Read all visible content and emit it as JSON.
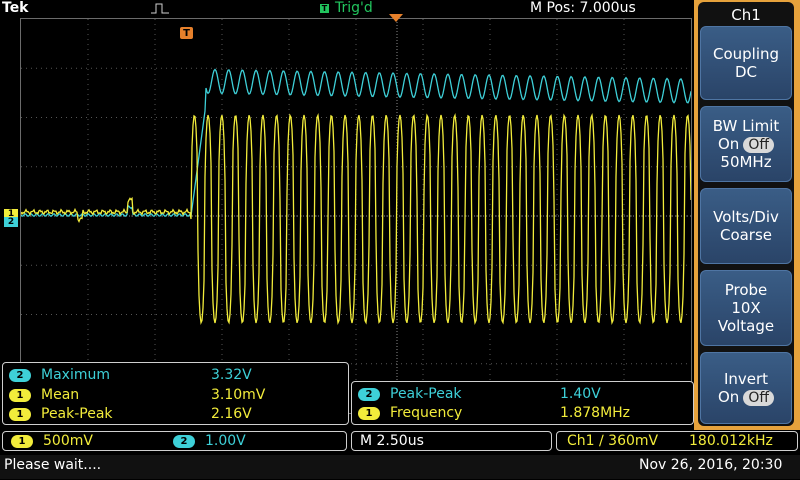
{
  "header": {
    "brand": "Tek",
    "trigger_status": "Trig'd",
    "m_pos": "M Pos: 7.000us"
  },
  "channels": {
    "ch1": {
      "label": "1",
      "color": "#f2ec3b"
    },
    "ch2": {
      "label": "2",
      "color": "#3ed0d8"
    }
  },
  "trigger_marker": {
    "label": "T"
  },
  "measurements_left": [
    {
      "channel": "2",
      "name": "Maximum",
      "value": "3.32V"
    },
    {
      "channel": "1",
      "name": "Mean",
      "value": "3.10mV"
    },
    {
      "channel": "1",
      "name": "Peak-Peak",
      "value": "2.16V"
    }
  ],
  "measurements_right": [
    {
      "channel": "2",
      "name": "Peak-Peak",
      "value": "1.40V"
    },
    {
      "channel": "1",
      "name": "Frequency",
      "value": "1.878MHz"
    }
  ],
  "status_bar": {
    "ch1_scale": "500mV",
    "ch2_scale": "1.00V",
    "timebase": "M 2.50us",
    "trigger_info": "Ch1 ∕ 360mV",
    "trigger_freq": "180.012kHz"
  },
  "bottom": {
    "message": "Please wait....",
    "datetime": "Nov 26, 2016, 20:30"
  },
  "side_menu": {
    "title": "Ch1",
    "coupling_label": "Coupling",
    "coupling_value": "DC",
    "bw_label": "BW Limit",
    "bw_on": "On",
    "bw_off": "Off",
    "bw_value": "50MHz",
    "volts_label": "Volts/Div",
    "volts_value": "Coarse",
    "probe_label": "Probe",
    "probe_value": "10X",
    "probe_type": "Voltage",
    "invert_label": "Invert",
    "invert_on": "On",
    "invert_off": "Off"
  }
}
